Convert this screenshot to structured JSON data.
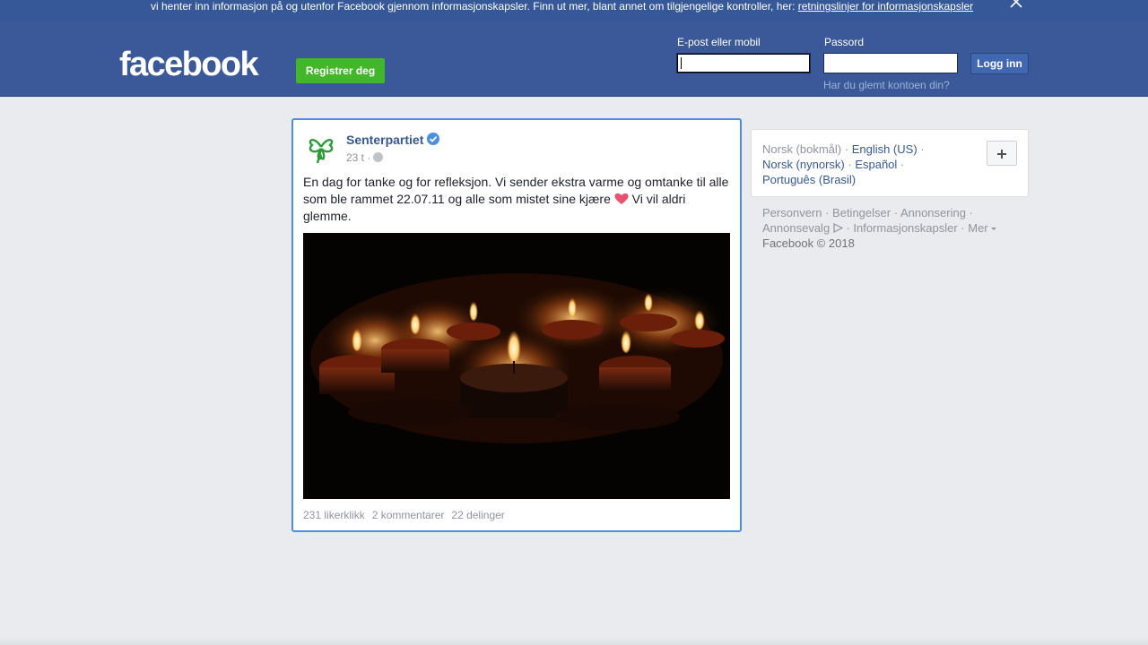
{
  "cookie_banner": {
    "text": "vi henter inn informasjon på og utenfor Facebook gjennom informasjonskapsler. Finn ut mer, blant annet om tilgjengelige kontroller, her: ",
    "link": "retningslinjer for informasjonskapsler"
  },
  "header": {
    "logo": "facebook",
    "register_label": "Registrer deg",
    "email_label": "E-post eller mobil",
    "email_value": "",
    "password_label": "Passord",
    "password_value": "",
    "login_label": "Logg inn",
    "forgot_label": "Har du glemt kontoen din?"
  },
  "post": {
    "author": "Senterpartiet",
    "time": "23 t ·",
    "text": "En dag for tanke og for refleksjon. Vi sender ekstra varme og omtanke til alle som ble rammet 22.07.11 og alle som mistet sine kjære",
    "text_after": " Vi vil aldri glemme.",
    "likes": "231 likerklikk",
    "comments": "2 kommentarer",
    "shares": "22 delinger"
  },
  "languages": {
    "current": "Norsk (bokmål)",
    "sep": " · ",
    "items": [
      "English (US)",
      "Norsk (nynorsk)",
      "Español",
      "Português (Brasil)"
    ]
  },
  "footer": {
    "links": [
      "Personvern",
      "Betingelser",
      "Annonsering",
      "Annonsevalg",
      "Informasjonskapsler",
      "Mer"
    ],
    "copyright": "Facebook © 2018"
  },
  "colors": {
    "brand": "#3b5998",
    "register_green": "#42b72a",
    "link_blue": "#365899",
    "highlight_border": "#4a90e2"
  }
}
